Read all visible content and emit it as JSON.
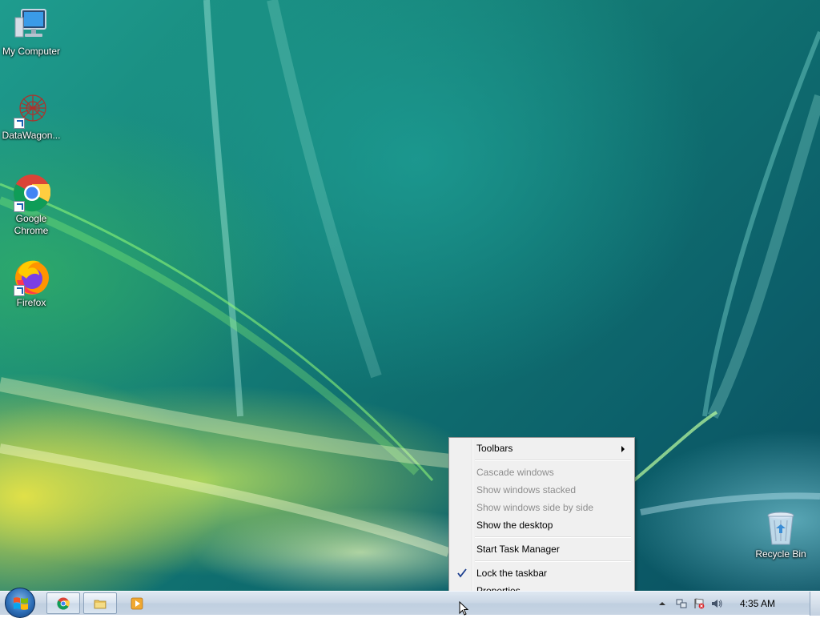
{
  "desktop": {
    "icons": [
      {
        "label": "My Computer",
        "icon": "computer-icon"
      },
      {
        "label": "DataWagon...",
        "icon": "datawagon-icon"
      },
      {
        "label": "Google Chrome",
        "icon": "chrome-icon"
      },
      {
        "label": "Firefox",
        "icon": "firefox-icon"
      },
      {
        "label": "Recycle Bin",
        "icon": "recycle-bin-icon"
      }
    ]
  },
  "context_menu": {
    "items": [
      {
        "label": "Toolbars",
        "enabled": true,
        "has_submenu": true
      },
      {
        "label": "Cascade windows",
        "enabled": false
      },
      {
        "label": "Show windows stacked",
        "enabled": false
      },
      {
        "label": "Show windows side by side",
        "enabled": false
      },
      {
        "label": "Show the desktop",
        "enabled": true
      },
      {
        "label": "Start Task Manager",
        "enabled": true
      },
      {
        "label": "Lock the taskbar",
        "enabled": true,
        "checked": true
      },
      {
        "label": "Properties",
        "enabled": true
      }
    ]
  },
  "taskbar": {
    "pinned": [
      {
        "icon": "chrome-icon"
      },
      {
        "icon": "folder-icon"
      },
      {
        "icon": "media-player-icon"
      }
    ],
    "tray_icons": [
      "chevron-up-icon",
      "network-icon",
      "action-center-icon",
      "volume-icon"
    ],
    "clock": "4:35 AM"
  },
  "colors": {
    "menu_background": "#f0f0f0",
    "disabled_text": "#8d8d8d",
    "taskbar": "#c9d6e4"
  }
}
